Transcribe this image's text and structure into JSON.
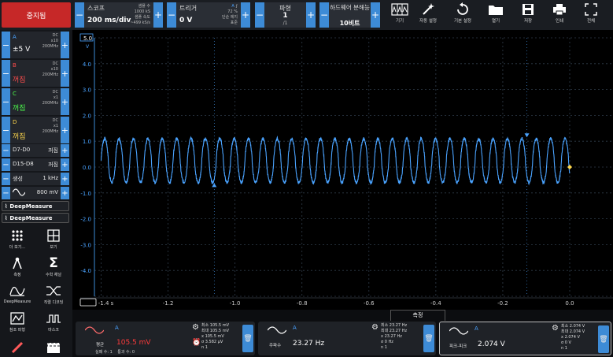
{
  "toolbar": {
    "stop_label": "중지됨",
    "scope": {
      "title": "스코프",
      "timebase": "200 ms/div",
      "info1": "샘플 수",
      "info2": "1000 kS",
      "info3": "샘플 속도",
      "info4": "~499 kS/s"
    },
    "trigger": {
      "title": "트리거",
      "level": "0 V",
      "info1": "72 %",
      "info2": "단순 에지",
      "info3": "표준",
      "trig_ch": "A"
    },
    "waveform": {
      "title": "파형",
      "value": "1",
      "sub": "/1"
    },
    "hw": {
      "title": "하드웨어 분해능",
      "value": "10비트"
    },
    "tools": [
      {
        "label": "기기",
        "icon": "channels-icon"
      },
      {
        "label": "자동 설정",
        "icon": "wand-icon"
      },
      {
        "label": "기본 설정",
        "icon": "reset-icon"
      },
      {
        "label": "열기",
        "icon": "folder-icon"
      },
      {
        "label": "저장",
        "icon": "save-icon"
      },
      {
        "label": "인쇄",
        "icon": "print-icon"
      },
      {
        "label": "전체",
        "icon": "fullscreen-icon"
      }
    ]
  },
  "channels": [
    {
      "name": "A",
      "value": "±5 V",
      "coupling": "DC",
      "probe": "x10",
      "bw": "200MHz",
      "color": "#4aa3ff",
      "value_color": "#ffffff"
    },
    {
      "name": "B",
      "value": "꺼짐",
      "coupling": "DC",
      "probe": "x10",
      "bw": "200MHz",
      "color": "#ff4d4d",
      "value_color": "#ff4d4d"
    },
    {
      "name": "C",
      "value": "꺼짐",
      "coupling": "DC",
      "probe": "x1",
      "bw": "200MHz",
      "color": "#4dff4d",
      "value_color": "#4dff4d"
    },
    {
      "name": "D",
      "value": "꺼짐",
      "coupling": "DC",
      "probe": "x1",
      "bw": "200MHz",
      "color": "#ffd84d",
      "value_color": "#ffd84d"
    }
  ],
  "digital": [
    {
      "name": "D7-D0",
      "value": "꺼짐"
    },
    {
      "name": "D15-D8",
      "value": "꺼짐"
    }
  ],
  "generator": {
    "label": "생성",
    "freq": "1 kHz",
    "amp": "800 mV"
  },
  "deepmeasure": [
    "DeepMeasure",
    "DeepMeasure"
  ],
  "left_tools": [
    {
      "label": "더 보기...",
      "icon": "more-icon"
    },
    {
      "label": "보기",
      "icon": "view-icon"
    },
    {
      "label": "측정",
      "icon": "measure-icon"
    },
    {
      "label": "수학 채널",
      "icon": "sigma-icon"
    },
    {
      "label": "DeepMeasure",
      "icon": "deepmeasure-icon"
    },
    {
      "label": "직렬 디코딩",
      "icon": "decode-icon"
    },
    {
      "label": "참조 파형",
      "icon": "reference-icon"
    },
    {
      "label": "마스크",
      "icon": "mask-icon"
    },
    {
      "label": "",
      "icon": "ruler-icon"
    },
    {
      "label": "",
      "icon": "clapper-icon"
    }
  ],
  "plot": {
    "y_top_label": "5.0",
    "y_unit": "V",
    "y_ticks": [
      "4.0",
      "3.0",
      "2.0",
      "1.0",
      "0.0",
      "-1.0",
      "-2.0",
      "-3.0",
      "-4.0"
    ],
    "x_ticks": [
      "-1.4 s",
      "-1.2",
      "-1.0",
      "-0.8",
      "-0.6",
      "-0.4",
      "-0.2",
      "0.0"
    ],
    "trace_color": "#4aa3ff",
    "grid_color": "#2f3c4a"
  },
  "chart_data": {
    "type": "line",
    "x": [
      -1.4,
      0.0
    ],
    "ylim": [
      -5,
      5
    ],
    "xlim": [
      -1.42,
      0.0
    ],
    "frequency_hz": 23.27,
    "amplitude_v": [
      -0.6,
      1.1
    ],
    "series": [
      {
        "name": "A"
      }
    ]
  },
  "measurements": {
    "tab": "측정",
    "cards": [
      {
        "ch": "A",
        "name": "평균",
        "value": "105.5 mV",
        "value_color": "#ff3b3b",
        "extra1": "실패 수:",
        "extra1v": "1",
        "extra2": "통과 수:",
        "extra2v": "0",
        "stats": [
          [
            "최소",
            "105.5 mV"
          ],
          [
            "최대",
            "105.5 mV"
          ],
          [
            "x",
            "105.5 mV"
          ],
          [
            "σ",
            "3.582 μV"
          ],
          [
            "n",
            "1"
          ]
        ]
      },
      {
        "ch": "A",
        "name": "주파수",
        "value": "23.27 Hz",
        "value_color": "#ffffff",
        "stats": [
          [
            "최소",
            "23.27 Hz"
          ],
          [
            "최대",
            "23.27 Hz"
          ],
          [
            "x",
            "23.27 Hz"
          ],
          [
            "σ",
            "0 Hz"
          ],
          [
            "n",
            "1"
          ]
        ]
      },
      {
        "ch": "A",
        "name": "피크-피크",
        "value": "2.074 V",
        "value_color": "#ffffff",
        "stats": [
          [
            "최소",
            "2.074 V"
          ],
          [
            "최대",
            "2.074 V"
          ],
          [
            "x",
            "2.074 V"
          ],
          [
            "σ",
            "0 V"
          ],
          [
            "n",
            "1"
          ]
        ]
      }
    ]
  }
}
